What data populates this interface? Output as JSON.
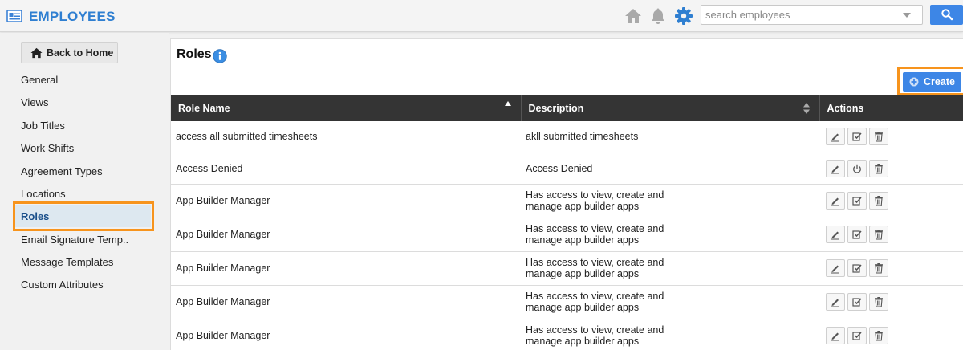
{
  "header": {
    "app_title": "EMPLOYEES",
    "icons": [
      "app-logo-icon",
      "home-icon",
      "bell-icon",
      "gear-icon",
      "search-icon"
    ],
    "search": {
      "placeholder": "search employees",
      "value": ""
    }
  },
  "sidebar": {
    "back_label": "Back to Home",
    "items": [
      {
        "label": "General"
      },
      {
        "label": "Views"
      },
      {
        "label": "Job Titles"
      },
      {
        "label": "Work Shifts"
      },
      {
        "label": "Agreement Types"
      },
      {
        "label": "Locations"
      },
      {
        "label": "Roles",
        "active": true
      },
      {
        "label": "Email Signature Temp.."
      },
      {
        "label": "Message Templates"
      },
      {
        "label": "Custom Attributes"
      }
    ]
  },
  "main": {
    "title": "Roles",
    "create_label": "Create",
    "columns": [
      "Role Name",
      "Description",
      "Actions"
    ],
    "rows": [
      {
        "name": "access all submitted timesheets",
        "description": "akll submitted timesheets",
        "actions": [
          "edit-icon",
          "assign-icon",
          "trash-icon"
        ]
      },
      {
        "name": "Access Denied",
        "description": "Access Denied",
        "actions": [
          "edit-icon",
          "power-icon",
          "trash-icon"
        ]
      },
      {
        "name": "App Builder Manager",
        "description": "Has access to view, create and\nmanage app builder apps",
        "actions": [
          "edit-icon",
          "assign-icon",
          "trash-icon"
        ]
      },
      {
        "name": "App Builder Manager",
        "description": "Has access to view, create and\nmanage app builder apps",
        "actions": [
          "edit-icon",
          "assign-icon",
          "trash-icon"
        ]
      },
      {
        "name": "App Builder Manager",
        "description": "Has access to view, create and\nmanage app builder apps",
        "actions": [
          "edit-icon",
          "assign-icon",
          "trash-icon"
        ]
      },
      {
        "name": "App Builder Manager",
        "description": "Has access to view, create and\nmanage app builder apps",
        "actions": [
          "edit-icon",
          "assign-icon",
          "trash-icon"
        ]
      },
      {
        "name": "App Builder Manager",
        "description": "Has access to view, create and\nmanage app builder apps",
        "actions": [
          "edit-icon",
          "assign-icon",
          "trash-icon"
        ]
      }
    ]
  },
  "colors": {
    "accent": "#2f7fd1",
    "button_blue": "#3d86e6",
    "table_header": "#343434",
    "highlight": "#f7941d"
  }
}
